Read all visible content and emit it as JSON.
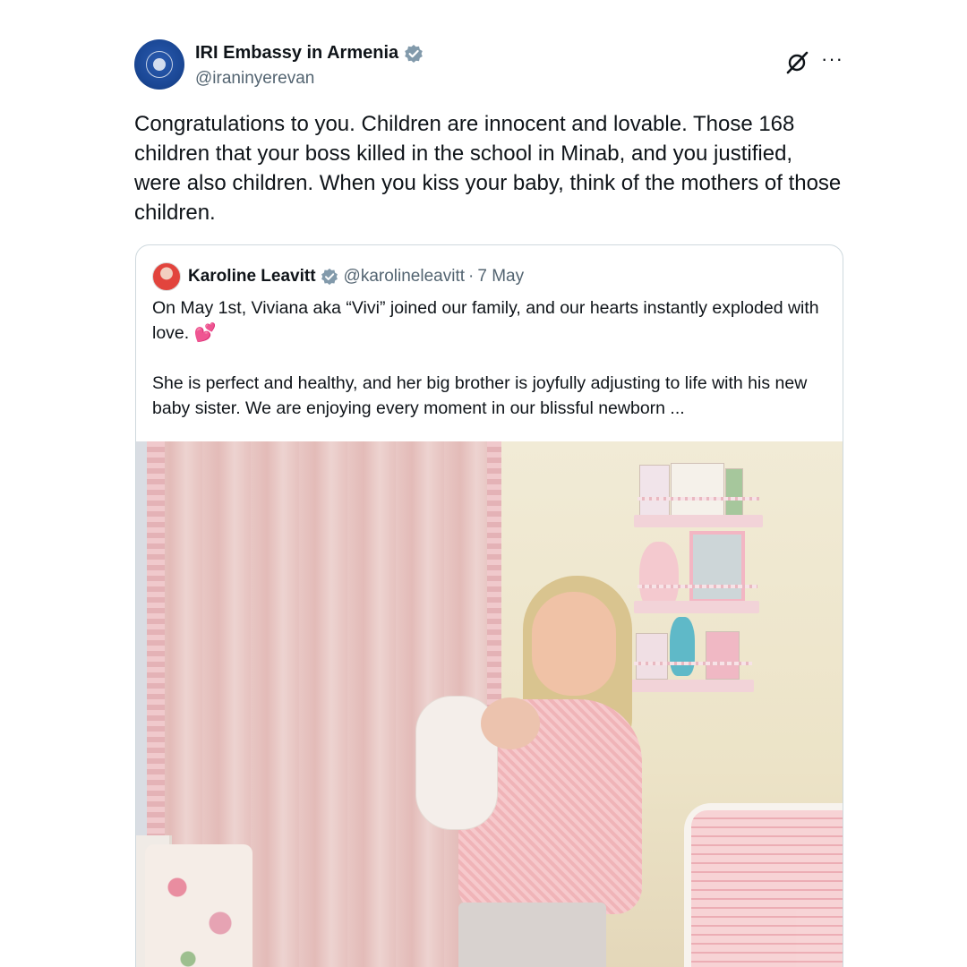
{
  "tweet": {
    "author": {
      "display_name": "IRI Embassy in Armenia",
      "handle": "@iraninyerevan",
      "verified": true,
      "avatar_icon": "embassy-emblem-avatar"
    },
    "text": "Congratulations to you. Children are innocent and lovable. Those 168 children that your boss killed in the school in Minab, and you justified, were also children. When you kiss your baby, think of the mothers of those children.",
    "actions": {
      "grok_icon": "grok-icon",
      "more_label": "···"
    }
  },
  "quoted_tweet": {
    "author": {
      "display_name": "Karoline Leavitt",
      "handle": "@karolineleavitt",
      "verified": true
    },
    "separator": "·",
    "date": "7 May",
    "paragraph_1": "On May 1st, Viviana aka “Vivi” joined our family, and our hearts instantly exploded with love.",
    "paragraph_1_emoji": "💕",
    "paragraph_2": "She is perfect and healthy, and her big brother is joyfully adjusting to life with his new baby sister. We are enjoying every moment in our blissful newborn ...",
    "media": {
      "type": "photo"
    }
  },
  "colors": {
    "text_primary": "#0f1419",
    "text_secondary": "#536471",
    "verified_blue": "#1d9bf0",
    "border": "#cfd9de"
  }
}
